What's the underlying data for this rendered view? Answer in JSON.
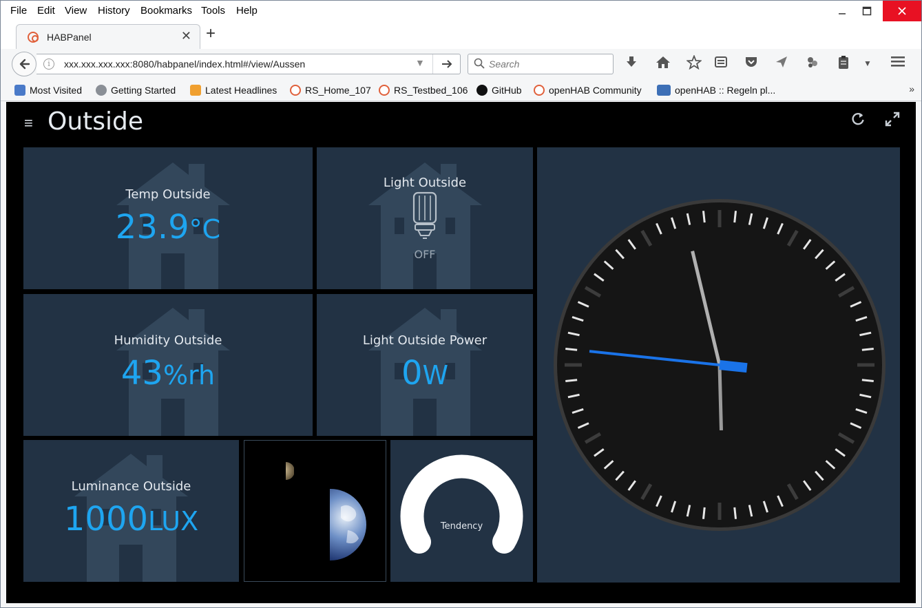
{
  "menu": {
    "items": [
      {
        "accel": "F",
        "rest": "ile"
      },
      {
        "accel": "E",
        "rest": "dit"
      },
      {
        "accel": "V",
        "rest": "iew"
      },
      {
        "accel": "",
        "pre": "Hi",
        "accel2": "s",
        "rest": "tory"
      },
      {
        "accel": "B",
        "rest": "ookmarks"
      },
      {
        "accel": "T",
        "rest": "ools"
      },
      {
        "accel": "H",
        "rest": "elp"
      }
    ],
    "labels": [
      "File",
      "Edit",
      "View",
      "History",
      "Bookmarks",
      "Tools",
      "Help"
    ]
  },
  "tab": {
    "title": "HABPanel",
    "close": "✕",
    "new_tab": "+"
  },
  "nav": {
    "url": "xxx.xxx.xxx.xxx:8080/habpanel/index.html#/view/Aussen",
    "search_placeholder": "Search"
  },
  "bookmarks": [
    {
      "label": "Most Visited",
      "icon": "most-visited-icon"
    },
    {
      "label": "Getting Started",
      "icon": "globe-icon"
    },
    {
      "label": "Latest Headlines",
      "icon": "rss-icon"
    },
    {
      "label": "RS_Home_107",
      "icon": "openhab-icon"
    },
    {
      "label": "RS_Testbed_106",
      "icon": "openhab-icon"
    },
    {
      "label": "GitHub",
      "icon": "github-icon"
    },
    {
      "label": "openHAB Community",
      "icon": "openhab-icon"
    },
    {
      "label": "openHAB :: Regeln pl...",
      "icon": "cubes-icon"
    }
  ],
  "dashboard": {
    "title": "Outside",
    "tiles": {
      "temp": {
        "label": "Temp Outside",
        "value": "23.9",
        "unit": "°C"
      },
      "light": {
        "label": "Light Outside",
        "state": "OFF"
      },
      "humidity": {
        "label": "Humidity Outside",
        "value": "43",
        "unit": "%rh"
      },
      "power": {
        "label": "Light Outside Power",
        "value": "0",
        "unit": "W"
      },
      "luminance": {
        "label": "Luminance Outside",
        "value": "1000",
        "unit": "LUX"
      },
      "gauge": {
        "label": "Tendency"
      }
    },
    "clock": {
      "hour": 11,
      "minute": 57,
      "second": 46
    }
  },
  "colors": {
    "tile_bg": "#223244",
    "value": "#1ea5f0",
    "clock_second_hand": "#1a73e8"
  }
}
